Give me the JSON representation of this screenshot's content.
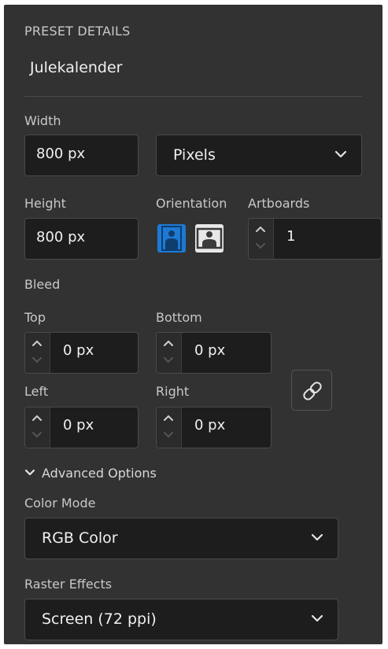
{
  "preset": {
    "section_title": "PRESET DETAILS",
    "name": "Julekalender"
  },
  "width": {
    "label": "Width",
    "value": "800 px",
    "unit": "Pixels"
  },
  "height": {
    "label": "Height",
    "value": "800 px"
  },
  "orientation": {
    "label": "Orientation",
    "selected": "portrait"
  },
  "artboards": {
    "label": "Artboards",
    "value": "1"
  },
  "bleed": {
    "label": "Bleed",
    "top": {
      "label": "Top",
      "value": "0 px"
    },
    "bottom": {
      "label": "Bottom",
      "value": "0 px"
    },
    "left": {
      "label": "Left",
      "value": "0 px"
    },
    "right": {
      "label": "Right",
      "value": "0 px"
    }
  },
  "advanced": {
    "label": "Advanced Options",
    "expanded": true
  },
  "color_mode": {
    "label": "Color Mode",
    "value": "RGB Color"
  },
  "raster_effects": {
    "label": "Raster Effects",
    "value": "Screen (72 ppi)"
  },
  "colors": {
    "panel": "#323232",
    "field": "#1d1d1d",
    "accent": "#1d7ad4",
    "text": "#f0f0f0"
  }
}
